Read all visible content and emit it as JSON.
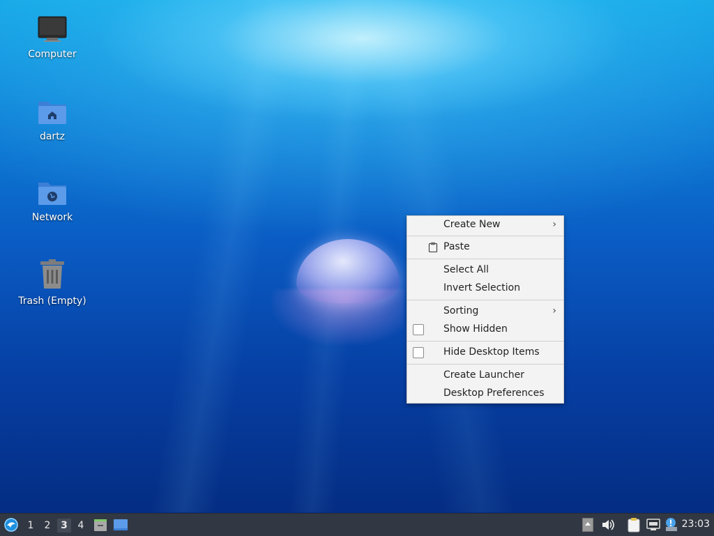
{
  "desktop": {
    "icons": [
      {
        "label": "Computer",
        "icon": "computer-icon"
      },
      {
        "label": "dartz",
        "icon": "home-folder-icon"
      },
      {
        "label": "Network",
        "icon": "network-folder-icon"
      },
      {
        "label": "Trash (Empty)",
        "icon": "trash-icon"
      }
    ]
  },
  "context_menu": {
    "create_new": "Create New",
    "paste": "Paste",
    "select_all": "Select All",
    "invert_selection": "Invert Selection",
    "sorting": "Sorting",
    "show_hidden": "Show Hidden",
    "hide_desktop_items": "Hide Desktop Items",
    "create_launcher": "Create Launcher",
    "desktop_preferences": "Desktop Preferences",
    "submenu_arrow": "›"
  },
  "panel": {
    "workspaces": [
      "1",
      "2",
      "3",
      "4"
    ],
    "active_workspace": "3",
    "clock": "23:03"
  },
  "colors": {
    "panel_bg": "#323843",
    "menu_bg": "#f3f3f3",
    "desktop_accent": "#0d7fd6"
  }
}
